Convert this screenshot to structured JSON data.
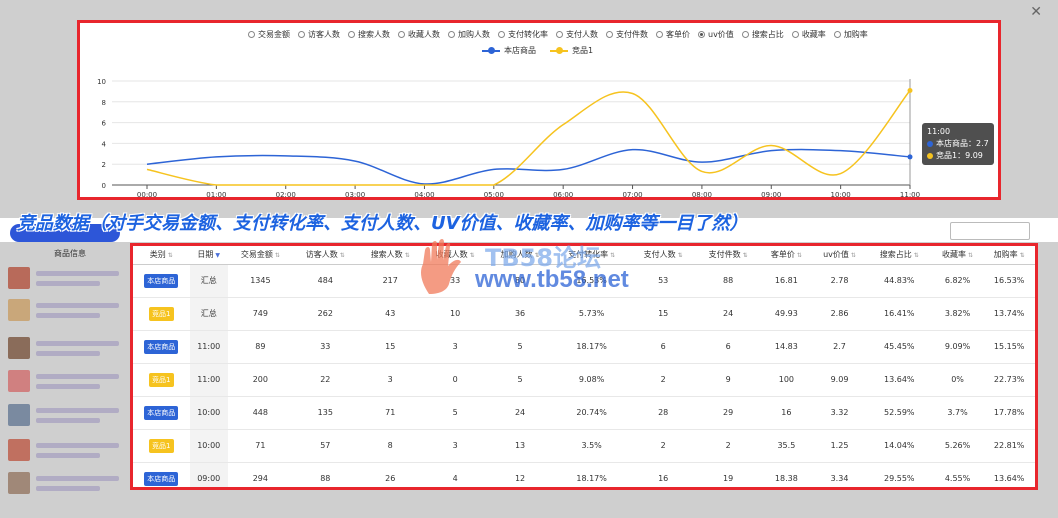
{
  "chart_panel": {
    "metrics": [
      {
        "label": "交易金额",
        "selected": false
      },
      {
        "label": "访客人数",
        "selected": false
      },
      {
        "label": "搜索人数",
        "selected": false
      },
      {
        "label": "收藏人数",
        "selected": false
      },
      {
        "label": "加购人数",
        "selected": false
      },
      {
        "label": "支付转化率",
        "selected": false
      },
      {
        "label": "支付人数",
        "selected": false
      },
      {
        "label": "支付件数",
        "selected": false
      },
      {
        "label": "客单价",
        "selected": false
      },
      {
        "label": "uv价值",
        "selected": true
      },
      {
        "label": "搜索占比",
        "selected": false
      },
      {
        "label": "收藏率",
        "selected": false
      },
      {
        "label": "加购率",
        "selected": false
      }
    ],
    "tooltip": {
      "time": "11:00",
      "rows": [
        "本店商品：2.7",
        "竞品1：9.09"
      ]
    }
  },
  "chart_data": {
    "type": "line",
    "x": [
      "00:00",
      "01:00",
      "02:00",
      "03:00",
      "04:00",
      "05:00",
      "06:00",
      "07:00",
      "08:00",
      "09:00",
      "10:00",
      "11:00"
    ],
    "ylim": [
      0,
      10
    ],
    "yticks": [
      0,
      2,
      4,
      6,
      8,
      10
    ],
    "series": [
      {
        "name": "本店商品",
        "color": "#2d64d6",
        "values": [
          2.0,
          2.7,
          2.8,
          2.3,
          0.1,
          1.5,
          1.5,
          3.4,
          2.2,
          3.3,
          3.3,
          2.7
        ]
      },
      {
        "name": "竞品1",
        "color": "#f6c31f",
        "values": [
          1.5,
          0,
          0,
          0,
          0,
          0,
          5.8,
          8.8,
          1.3,
          3.8,
          1.1,
          9.09
        ]
      }
    ]
  },
  "overlay": {
    "title": "竞品数据（对手交易金额、支付转化率、支付人数、UV价值、收藏率、加购率等一目了然）"
  },
  "watermark": {
    "line1": "TB58论坛",
    "line2": "www.tb58.net"
  },
  "left_column": {
    "header": "商品信息"
  },
  "table": {
    "headers": [
      "类别",
      "日期",
      "交易金额",
      "访客人数",
      "搜索人数",
      "收藏人数",
      "加购人数",
      "支付转化率",
      "支付人数",
      "支付件数",
      "客单价",
      "uv价值",
      "搜索占比",
      "收藏率",
      "加购率"
    ],
    "rows": [
      {
        "type": "本店商品",
        "color": "blue",
        "cells": [
          "汇总",
          "1345",
          "484",
          "217",
          "33",
          "80",
          "16.53%",
          "53",
          "88",
          "16.81",
          "2.78",
          "44.83%",
          "6.82%",
          "16.53%"
        ]
      },
      {
        "type": "竞品1",
        "color": "yellow",
        "cells": [
          "汇总",
          "749",
          "262",
          "43",
          "10",
          "36",
          "5.73%",
          "15",
          "24",
          "49.93",
          "2.86",
          "16.41%",
          "3.82%",
          "13.74%"
        ]
      },
      {
        "type": "本店商品",
        "color": "blue",
        "cells": [
          "11:00",
          "89",
          "33",
          "15",
          "3",
          "5",
          "18.17%",
          "6",
          "6",
          "14.83",
          "2.7",
          "45.45%",
          "9.09%",
          "15.15%"
        ]
      },
      {
        "type": "竞品1",
        "color": "yellow",
        "cells": [
          "11:00",
          "200",
          "22",
          "3",
          "0",
          "5",
          "9.08%",
          "2",
          "9",
          "100",
          "9.09",
          "13.64%",
          "0%",
          "22.73%"
        ]
      },
      {
        "type": "本店商品",
        "color": "blue",
        "cells": [
          "10:00",
          "448",
          "135",
          "71",
          "5",
          "24",
          "20.74%",
          "28",
          "29",
          "16",
          "3.32",
          "52.59%",
          "3.7%",
          "17.78%"
        ]
      },
      {
        "type": "竞品1",
        "color": "yellow",
        "cells": [
          "10:00",
          "71",
          "57",
          "8",
          "3",
          "13",
          "3.5%",
          "2",
          "2",
          "35.5",
          "1.25",
          "14.04%",
          "5.26%",
          "22.81%"
        ]
      },
      {
        "type": "本店商品",
        "color": "blue",
        "cells": [
          "09:00",
          "294",
          "88",
          "26",
          "4",
          "12",
          "18.17%",
          "16",
          "19",
          "18.38",
          "3.34",
          "29.55%",
          "4.55%",
          "13.64%"
        ]
      }
    ]
  }
}
